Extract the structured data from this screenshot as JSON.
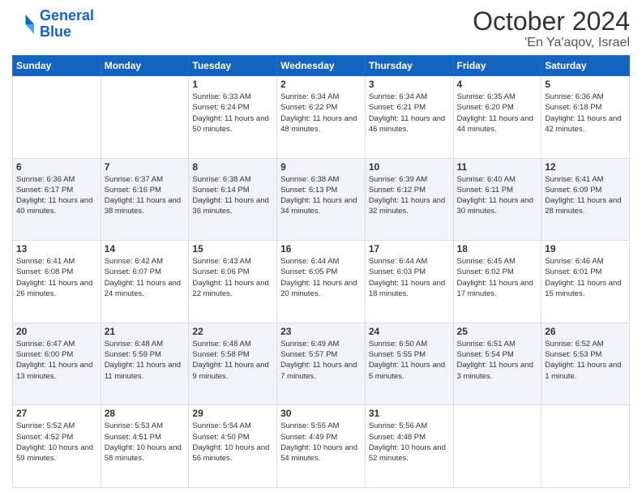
{
  "header": {
    "logo_line1": "General",
    "logo_line2": "Blue",
    "month": "October 2024",
    "location": "'En Ya'aqov, Israel"
  },
  "weekdays": [
    "Sunday",
    "Monday",
    "Tuesday",
    "Wednesday",
    "Thursday",
    "Friday",
    "Saturday"
  ],
  "weeks": [
    [
      {
        "day": "",
        "info": ""
      },
      {
        "day": "",
        "info": ""
      },
      {
        "day": "1",
        "info": "Sunrise: 6:33 AM\nSunset: 6:24 PM\nDaylight: 11 hours and 50 minutes."
      },
      {
        "day": "2",
        "info": "Sunrise: 6:34 AM\nSunset: 6:22 PM\nDaylight: 11 hours and 48 minutes."
      },
      {
        "day": "3",
        "info": "Sunrise: 6:34 AM\nSunset: 6:21 PM\nDaylight: 11 hours and 46 minutes."
      },
      {
        "day": "4",
        "info": "Sunrise: 6:35 AM\nSunset: 6:20 PM\nDaylight: 11 hours and 44 minutes."
      },
      {
        "day": "5",
        "info": "Sunrise: 6:36 AM\nSunset: 6:18 PM\nDaylight: 11 hours and 42 minutes."
      }
    ],
    [
      {
        "day": "6",
        "info": "Sunrise: 6:36 AM\nSunset: 6:17 PM\nDaylight: 11 hours and 40 minutes."
      },
      {
        "day": "7",
        "info": "Sunrise: 6:37 AM\nSunset: 6:16 PM\nDaylight: 11 hours and 38 minutes."
      },
      {
        "day": "8",
        "info": "Sunrise: 6:38 AM\nSunset: 6:14 PM\nDaylight: 11 hours and 36 minutes."
      },
      {
        "day": "9",
        "info": "Sunrise: 6:38 AM\nSunset: 6:13 PM\nDaylight: 11 hours and 34 minutes."
      },
      {
        "day": "10",
        "info": "Sunrise: 6:39 AM\nSunset: 6:12 PM\nDaylight: 11 hours and 32 minutes."
      },
      {
        "day": "11",
        "info": "Sunrise: 6:40 AM\nSunset: 6:11 PM\nDaylight: 11 hours and 30 minutes."
      },
      {
        "day": "12",
        "info": "Sunrise: 6:41 AM\nSunset: 6:09 PM\nDaylight: 11 hours and 28 minutes."
      }
    ],
    [
      {
        "day": "13",
        "info": "Sunrise: 6:41 AM\nSunset: 6:08 PM\nDaylight: 11 hours and 26 minutes."
      },
      {
        "day": "14",
        "info": "Sunrise: 6:42 AM\nSunset: 6:07 PM\nDaylight: 11 hours and 24 minutes."
      },
      {
        "day": "15",
        "info": "Sunrise: 6:43 AM\nSunset: 6:06 PM\nDaylight: 11 hours and 22 minutes."
      },
      {
        "day": "16",
        "info": "Sunrise: 6:44 AM\nSunset: 6:05 PM\nDaylight: 11 hours and 20 minutes."
      },
      {
        "day": "17",
        "info": "Sunrise: 6:44 AM\nSunset: 6:03 PM\nDaylight: 11 hours and 18 minutes."
      },
      {
        "day": "18",
        "info": "Sunrise: 6:45 AM\nSunset: 6:02 PM\nDaylight: 11 hours and 17 minutes."
      },
      {
        "day": "19",
        "info": "Sunrise: 6:46 AM\nSunset: 6:01 PM\nDaylight: 11 hours and 15 minutes."
      }
    ],
    [
      {
        "day": "20",
        "info": "Sunrise: 6:47 AM\nSunset: 6:00 PM\nDaylight: 11 hours and 13 minutes."
      },
      {
        "day": "21",
        "info": "Sunrise: 6:48 AM\nSunset: 5:59 PM\nDaylight: 11 hours and 11 minutes."
      },
      {
        "day": "22",
        "info": "Sunrise: 6:48 AM\nSunset: 5:58 PM\nDaylight: 11 hours and 9 minutes."
      },
      {
        "day": "23",
        "info": "Sunrise: 6:49 AM\nSunset: 5:57 PM\nDaylight: 11 hours and 7 minutes."
      },
      {
        "day": "24",
        "info": "Sunrise: 6:50 AM\nSunset: 5:55 PM\nDaylight: 11 hours and 5 minutes."
      },
      {
        "day": "25",
        "info": "Sunrise: 6:51 AM\nSunset: 5:54 PM\nDaylight: 11 hours and 3 minutes."
      },
      {
        "day": "26",
        "info": "Sunrise: 6:52 AM\nSunset: 5:53 PM\nDaylight: 11 hours and 1 minute."
      }
    ],
    [
      {
        "day": "27",
        "info": "Sunrise: 5:52 AM\nSunset: 4:52 PM\nDaylight: 10 hours and 59 minutes."
      },
      {
        "day": "28",
        "info": "Sunrise: 5:53 AM\nSunset: 4:51 PM\nDaylight: 10 hours and 58 minutes."
      },
      {
        "day": "29",
        "info": "Sunrise: 5:54 AM\nSunset: 4:50 PM\nDaylight: 10 hours and 56 minutes."
      },
      {
        "day": "30",
        "info": "Sunrise: 5:55 AM\nSunset: 4:49 PM\nDaylight: 10 hours and 54 minutes."
      },
      {
        "day": "31",
        "info": "Sunrise: 5:56 AM\nSunset: 4:48 PM\nDaylight: 10 hours and 52 minutes."
      },
      {
        "day": "",
        "info": ""
      },
      {
        "day": "",
        "info": ""
      }
    ]
  ]
}
